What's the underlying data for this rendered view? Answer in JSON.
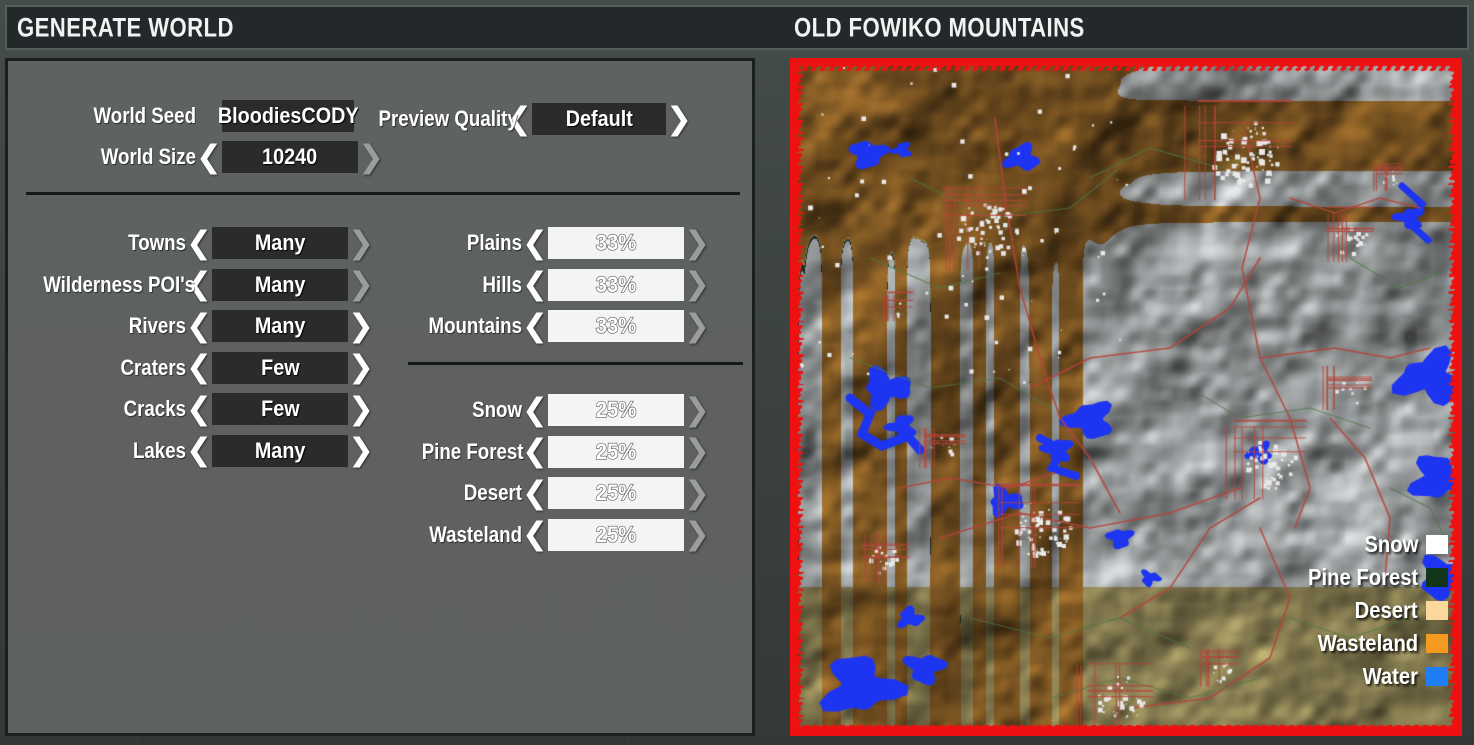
{
  "header": {
    "left_title": "GENERATE WORLD",
    "right_title": "OLD FOWIKO MOUNTAINS"
  },
  "icons": {
    "prev": "❮",
    "next": "❯",
    "prev_name": "chevron-left-icon",
    "next_name": "chevron-right-icon"
  },
  "settings": {
    "top_rows": [
      {
        "label": "World Seed",
        "value": "BloodiesCODY",
        "style": "dark",
        "prev": false,
        "next": false
      },
      {
        "label": "Preview Quality",
        "value": "Default",
        "style": "dark",
        "prev": true,
        "next": true
      },
      {
        "label": "World Size",
        "value": "10240",
        "style": "dark",
        "prev": true,
        "next": "disabled"
      }
    ],
    "left_column": [
      {
        "label": "Towns",
        "value": "Many",
        "style": "dark",
        "prev": true,
        "next": "disabled"
      },
      {
        "label": "Wilderness POI's",
        "value": "Many",
        "style": "dark",
        "prev": true,
        "next": "disabled"
      },
      {
        "label": "Rivers",
        "value": "Many",
        "style": "dark",
        "prev": true,
        "next": true
      },
      {
        "label": "Craters",
        "value": "Few",
        "style": "dark",
        "prev": true,
        "next": true
      },
      {
        "label": "Cracks",
        "value": "Few",
        "style": "dark",
        "prev": true,
        "next": true
      },
      {
        "label": "Lakes",
        "value": "Many",
        "style": "dark",
        "prev": true,
        "next": true
      }
    ],
    "terrain_column": [
      {
        "label": "Plains",
        "value": "33%",
        "style": "light",
        "prev": true,
        "next": "disabled"
      },
      {
        "label": "Hills",
        "value": "33%",
        "style": "light",
        "prev": true,
        "next": "disabled"
      },
      {
        "label": "Mountains",
        "value": "33%",
        "style": "light",
        "prev": true,
        "next": "disabled"
      }
    ],
    "biome_column": [
      {
        "label": "Snow",
        "value": "25%",
        "style": "light",
        "prev": true,
        "next": "disabled"
      },
      {
        "label": "Pine Forest",
        "value": "25%",
        "style": "light",
        "prev": true,
        "next": "disabled"
      },
      {
        "label": "Desert",
        "value": "25%",
        "style": "light",
        "prev": true,
        "next": "disabled"
      },
      {
        "label": "Wasteland",
        "value": "25%",
        "style": "light",
        "prev": true,
        "next": "disabled"
      }
    ]
  },
  "legend": [
    {
      "label": "Snow",
      "color": "#ffffff"
    },
    {
      "label": "Pine Forest",
      "color": "#11361b"
    },
    {
      "label": "Desert",
      "color": "#fad79a"
    },
    {
      "label": "Wasteland",
      "color": "#f59a1e"
    },
    {
      "label": "Water",
      "color": "#1d7ef5"
    }
  ],
  "map": {
    "border_color": "#ee1111",
    "biome_colors": {
      "wasteland": "#8a5f26",
      "desert": "#8d8355",
      "snow": "#a9adae",
      "pine_forest": "#28332c",
      "water": "#1d35f0",
      "road": "#b5443a",
      "trail": "#4e7a44",
      "poi": "#e8e8e8"
    }
  }
}
